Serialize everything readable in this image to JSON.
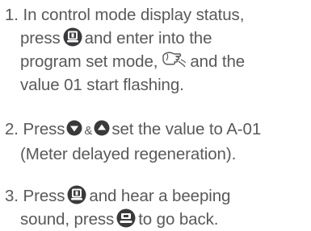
{
  "steps": [
    {
      "number": "1.",
      "lines": [
        "In control mode display status,",
        "press",
        "and enter into the",
        "program set mode,",
        "and the",
        "value 01 start flashing."
      ]
    },
    {
      "number": "2.",
      "lines": [
        "Press",
        "&",
        "set the value to A-01",
        "(Meter delayed regeneration)."
      ]
    },
    {
      "number": "3.",
      "lines": [
        "Press",
        "and hear a beeping",
        "sound, press",
        "to go back."
      ]
    }
  ],
  "icons": {
    "menu": "menu-button-icon",
    "hand": "pointing-hand-icon",
    "down": "down-arrow-button-icon",
    "up": "up-arrow-button-icon",
    "back": "return-button-icon"
  },
  "colors": {
    "text": "#58595b",
    "icon_fill": "#3a3a3c",
    "icon_glyph": "#ffffff",
    "background": "#ffffff"
  }
}
